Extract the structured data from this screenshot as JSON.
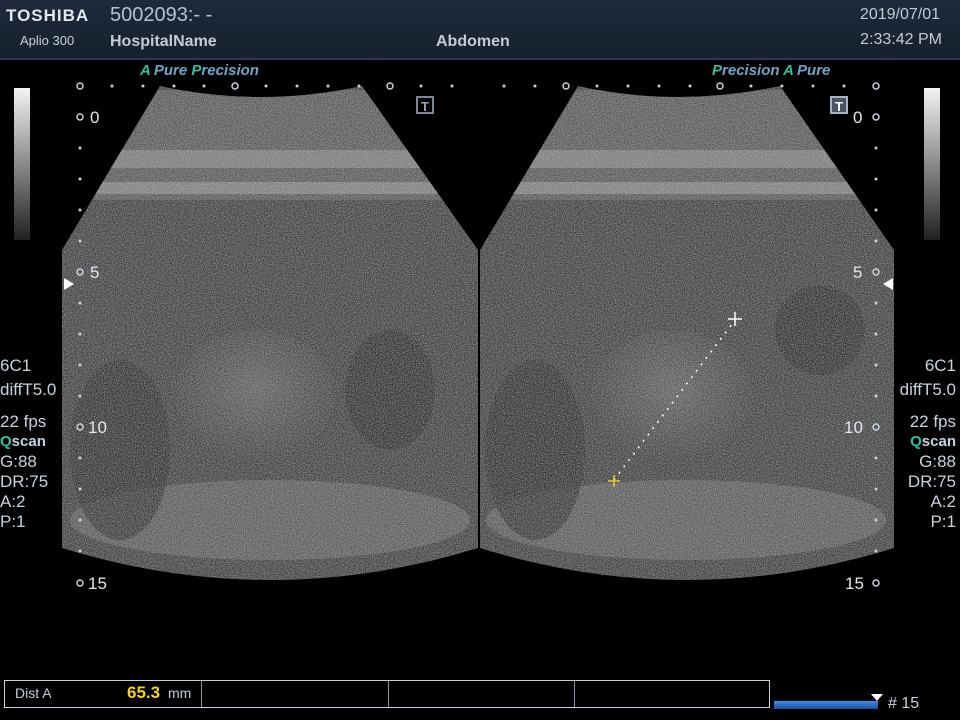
{
  "header": {
    "brand": "TOSHIBA",
    "model": "Aplio 300",
    "patient_id": "5002093:- -",
    "hospital": "HospitalName",
    "exam": "Abdomen",
    "date": "2019/07/01",
    "time": "2:33:42 PM"
  },
  "left_panel": {
    "preset_a": "A",
    "preset_pure": "Pure",
    "preset_p": "P",
    "preset_precision": "recision",
    "transducer": "6C1",
    "mode": "diffT5.0",
    "fps": "22 fps",
    "qscan_q": "Q",
    "qscan_rest": "scan",
    "gain": "G:88",
    "dr": "DR:75",
    "a": "A:2",
    "p": "P:1"
  },
  "right_panel": {
    "preset_p": "P",
    "preset_precision": "recision",
    "preset_a": "A",
    "preset_pure": "Pure",
    "transducer": "6C1",
    "mode": "diffT5.0",
    "fps": "22 fps",
    "qscan_q": "Q",
    "qscan_rest": "scan",
    "gain": "G:88",
    "dr": "DR:75",
    "a": "A:2",
    "p": "P:1"
  },
  "depth_scale": {
    "left": [
      "0",
      "5",
      "10",
      "15"
    ],
    "right": [
      "0",
      "5",
      "10",
      "15"
    ]
  },
  "t_marker": "T",
  "measurement": {
    "label": "Dist A",
    "value": "65.3",
    "unit": "mm"
  },
  "cine": {
    "frame": "# 15"
  },
  "colors": {
    "accent_teal": "#2fc0a0",
    "accent_blue": "#6fa6c8",
    "measurement_value": "#f5d21a",
    "caliper_start": "#e8d020",
    "caliper_end": "#ffffff"
  }
}
